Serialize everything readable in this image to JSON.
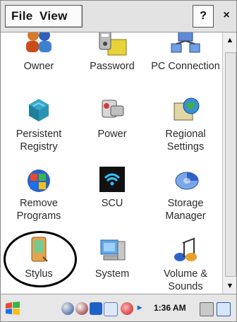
{
  "menubar": {
    "file_label": "File",
    "view_label": "View",
    "help_label": "?",
    "close_label": "×"
  },
  "control_panel": {
    "items": [
      {
        "label": "Owner",
        "icon": "owner-icon"
      },
      {
        "label": "Password",
        "icon": "password-icon"
      },
      {
        "label": "PC Connection",
        "icon": "pc-connection-icon"
      },
      {
        "label": "Persistent Registry",
        "icon": "persistent-registry-icon"
      },
      {
        "label": "Power",
        "icon": "power-icon"
      },
      {
        "label": "Regional Settings",
        "icon": "regional-settings-icon"
      },
      {
        "label": "Remove Programs",
        "icon": "remove-programs-icon"
      },
      {
        "label": "SCU",
        "icon": "scu-icon"
      },
      {
        "label": "Storage Manager",
        "icon": "storage-manager-icon"
      },
      {
        "label": "Stylus",
        "icon": "stylus-icon"
      },
      {
        "label": "System",
        "icon": "system-icon"
      },
      {
        "label": "Volume & Sounds",
        "icon": "volume-sounds-icon"
      }
    ]
  },
  "taskbar": {
    "clock": "1:36 AM"
  },
  "colors": {
    "menubar_bg": "#e3e3e3",
    "taskbar_bg": "#e7e7e7"
  }
}
